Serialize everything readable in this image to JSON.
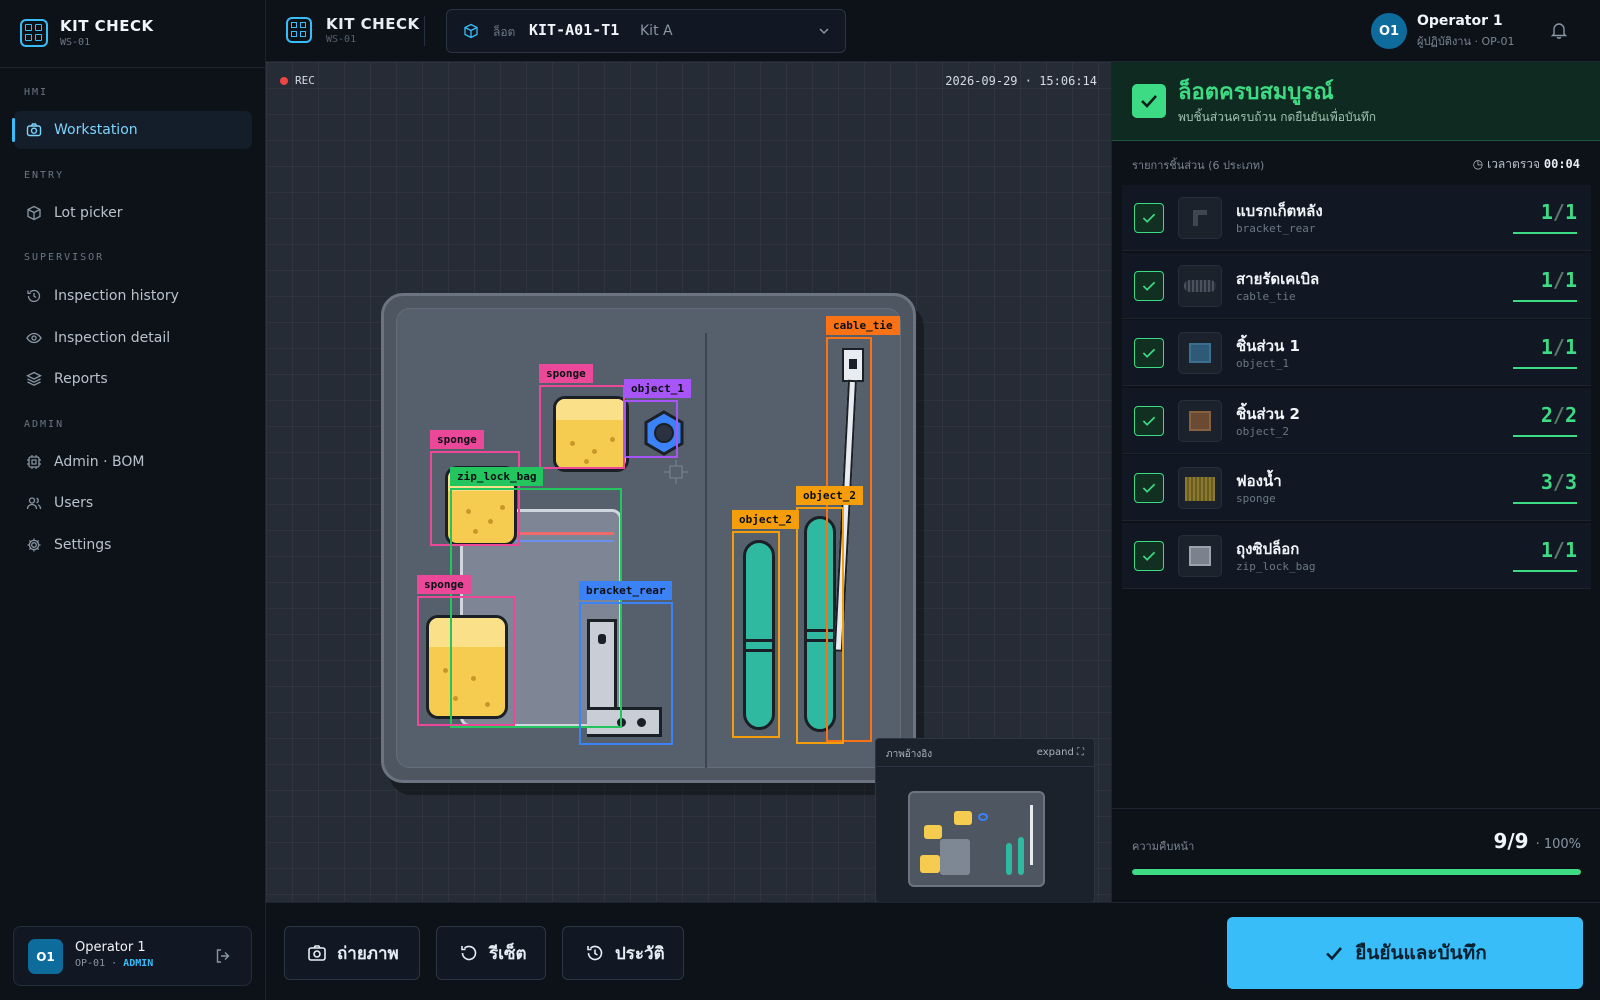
{
  "brand": {
    "title": "KIT CHECK",
    "station": "WS-01"
  },
  "sidebar": {
    "sections": {
      "hmi": "HMI",
      "entry": "ENTRY",
      "supervisor": "SUPERVISOR",
      "admin": "ADMIN"
    },
    "items": [
      {
        "label": "Workstation",
        "icon": "camera-icon",
        "active": true
      },
      {
        "label": "Lot picker",
        "icon": "box-icon"
      },
      {
        "label": "Inspection history",
        "icon": "history-icon"
      },
      {
        "label": "Inspection detail",
        "icon": "eye-icon"
      },
      {
        "label": "Reports",
        "icon": "layers-icon"
      },
      {
        "label": "Admin · BOM",
        "icon": "chip-icon"
      },
      {
        "label": "Users",
        "icon": "users-icon"
      },
      {
        "label": "Settings",
        "icon": "gear-icon"
      }
    ],
    "user": {
      "initials": "O1",
      "name": "Operator 1",
      "id": "OP-01 · ",
      "role": "ADMIN"
    }
  },
  "header": {
    "title": "KIT CHECK",
    "station": "WS-01",
    "lot_label": "ล็อต",
    "lot_code": "KIT-A01-T1",
    "kit_name": "Kit A",
    "user": {
      "initials": "O1",
      "name": "Operator 1",
      "role": "ผู้ปฏิบัติงาน · OP-01"
    }
  },
  "camera": {
    "rec": "REC",
    "timestamp": "2026-09-29 · 15:06:14",
    "detections": [
      "sponge",
      "object_1",
      "sponge",
      "zip_lock_bag",
      "sponge",
      "bracket_rear",
      "cable_tie",
      "object_2",
      "object_2"
    ],
    "thumbnail": {
      "label": "ภาพอ้างอิง",
      "expand": "expand"
    }
  },
  "panel": {
    "status_title": "ล็อตครบสมบูรณ์",
    "status_sub": "พบชิ้นส่วนครบถ้วน กดยืนยันเพื่อบันทึก",
    "list_header": "รายการชิ้นส่วน (6 ประเภท)",
    "timer_label": "เวลาตรวจ",
    "timer": "00:04",
    "parts": [
      {
        "name": "แบรกเก็ตหลัง",
        "code": "bracket_rear",
        "found": "1",
        "required": "1"
      },
      {
        "name": "สายรัดเคเบิล",
        "code": "cable_tie",
        "found": "1",
        "required": "1"
      },
      {
        "name": "ชิ้นส่วน 1",
        "code": "object_1",
        "found": "1",
        "required": "1"
      },
      {
        "name": "ชิ้นส่วน 2",
        "code": "object_2",
        "found": "2",
        "required": "2"
      },
      {
        "name": "ฟองน้ำ",
        "code": "sponge",
        "found": "3",
        "required": "3"
      },
      {
        "name": "ถุงซิปล็อก",
        "code": "zip_lock_bag",
        "found": "1",
        "required": "1"
      }
    ],
    "progress": {
      "label": "ความคืบหน้า",
      "value": "9/9",
      "pct_text": "· 100%",
      "fraction": 1.0
    }
  },
  "actions": {
    "capture": "ถ่ายภาพ",
    "reset": "รีเซ็ต",
    "history": "ประวัติ",
    "confirm": "ยืนยันและบันทึก"
  },
  "colors": {
    "accent": "#38bdf8",
    "ok": "#3ddc84",
    "sponge": "#ec4899",
    "object_1": "#a855f7",
    "zip_lock_bag": "#22c55e",
    "bracket_rear": "#3b82f6",
    "cable_tie": "#f97316",
    "object_2": "#f59e0b"
  }
}
